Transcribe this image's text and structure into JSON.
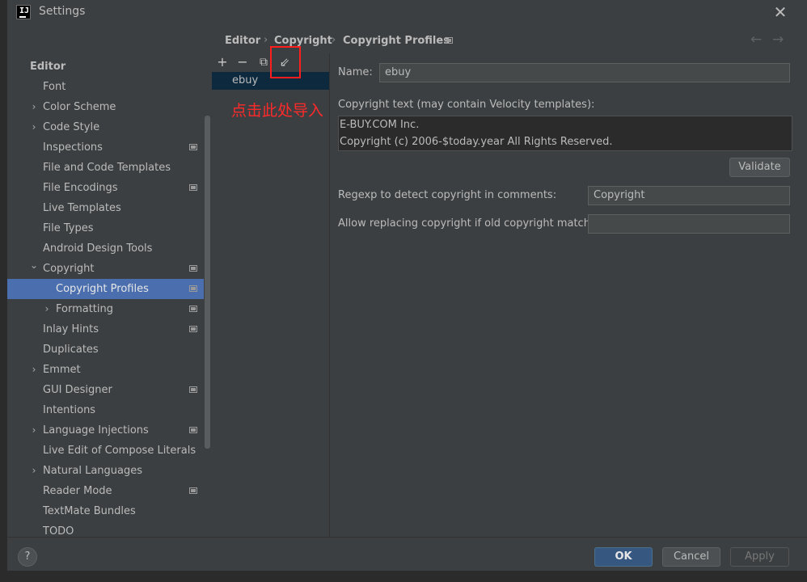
{
  "window": {
    "title": "Settings"
  },
  "search": {
    "placeholder": "",
    "value": ""
  },
  "tree": {
    "items": [
      {
        "label": "Editor",
        "indent": 0,
        "bold": true
      },
      {
        "label": "Font",
        "indent": 1
      },
      {
        "label": "Color Scheme",
        "indent": 1,
        "chevron": "right"
      },
      {
        "label": "Code Style",
        "indent": 1,
        "chevron": "right"
      },
      {
        "label": "Inspections",
        "indent": 1,
        "project": true
      },
      {
        "label": "File and Code Templates",
        "indent": 1
      },
      {
        "label": "File Encodings",
        "indent": 1,
        "project": true
      },
      {
        "label": "Live Templates",
        "indent": 1
      },
      {
        "label": "File Types",
        "indent": 1
      },
      {
        "label": "Android Design Tools",
        "indent": 1
      },
      {
        "label": "Copyright",
        "indent": 1,
        "chevron": "down",
        "project": true
      },
      {
        "label": "Copyright Profiles",
        "indent": 2,
        "project": true,
        "selected": true
      },
      {
        "label": "Formatting",
        "indent": 2,
        "chevron": "right",
        "project": true
      },
      {
        "label": "Inlay Hints",
        "indent": 1,
        "project": true
      },
      {
        "label": "Duplicates",
        "indent": 1
      },
      {
        "label": "Emmet",
        "indent": 1,
        "chevron": "right"
      },
      {
        "label": "GUI Designer",
        "indent": 1,
        "project": true
      },
      {
        "label": "Intentions",
        "indent": 1
      },
      {
        "label": "Language Injections",
        "indent": 1,
        "chevron": "right",
        "project": true
      },
      {
        "label": "Live Edit of Compose Literals",
        "indent": 1
      },
      {
        "label": "Natural Languages",
        "indent": 1,
        "chevron": "right"
      },
      {
        "label": "Reader Mode",
        "indent": 1,
        "project": true
      },
      {
        "label": "TextMate Bundles",
        "indent": 1
      },
      {
        "label": "TODO",
        "indent": 1
      }
    ]
  },
  "breadcrumb": {
    "items": [
      "Editor",
      "Copyright",
      "Copyright Profiles"
    ],
    "separator": "›",
    "back": "←",
    "forward": "→"
  },
  "profiles": {
    "toolbar": {
      "add": "+",
      "remove": "−",
      "copy": "⧉",
      "import": "⇙"
    },
    "items": [
      "ebuy"
    ],
    "selected": "ebuy"
  },
  "annotation": {
    "text": "点击此处导入",
    "color": "#ff2a2a"
  },
  "form": {
    "name_label": "Name:",
    "name_value": "ebuy",
    "copyright_label": "Copyright text (may contain Velocity templates):",
    "copyright_lines": [
      "E-BUY.COM Inc.",
      "Copyright (c) 2006-$today.year All Rights Reserved."
    ],
    "validate_label": "Validate",
    "regexp_label": "Regexp to detect copyright in comments:",
    "regexp_value": "Copyright",
    "allow_label": "Allow replacing copyright if old copyright matches:",
    "allow_value": ""
  },
  "footer": {
    "help": "?",
    "ok": "OK",
    "cancel": "Cancel",
    "apply": "Apply"
  },
  "colors": {
    "accent": "#4b6eaf",
    "background": "#3c3f41",
    "primary_button": "#365880"
  }
}
